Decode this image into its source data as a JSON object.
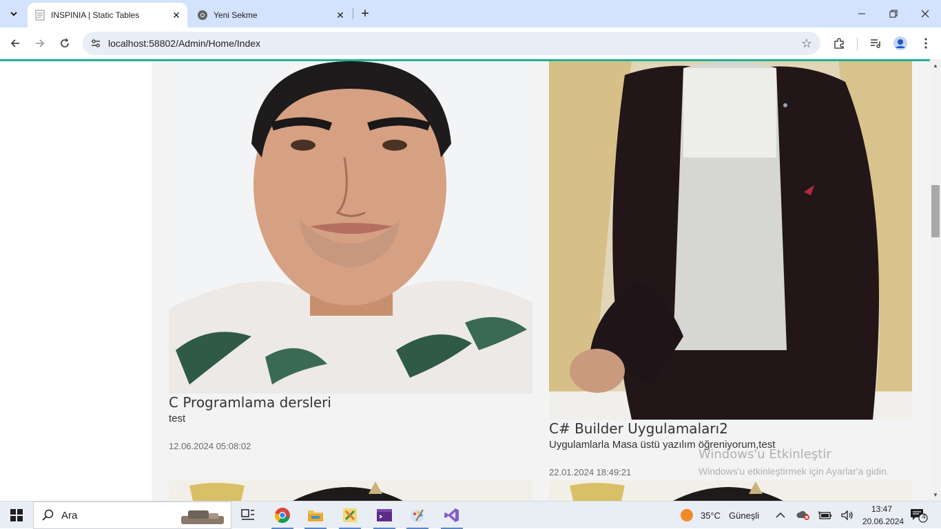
{
  "browser": {
    "tabs": [
      {
        "title": "INSPINIA | Static Tables",
        "active": true
      },
      {
        "title": "Yeni Sekme",
        "active": false
      }
    ],
    "url": "localhost:58802/Admin/Home/Index"
  },
  "colors": {
    "accent": "#1ab394",
    "tabstrip": "#d3e3fd",
    "content_bg": "#f3f3f4"
  },
  "cards": [
    {
      "title": "C Programlama dersleri",
      "description": "test",
      "date": "12.06.2024 05:08:02"
    },
    {
      "title": "C# Builder Uygulamaları2",
      "description": "Uygulamlarla Masa üstü yazılım öğreniyorum,test",
      "date": "22.01.2024 18:49:21"
    }
  ],
  "watermark": {
    "title": "Windows'u Etkinleştir",
    "subtitle": "Windows'u etkinleştirmek için Ayarlar'a gidin."
  },
  "taskbar": {
    "search_placeholder": "Ara",
    "weather_temp": "35°C",
    "weather_text": "Güneşli",
    "time": "13:47",
    "date": "20.06.2024",
    "notification_count": "4"
  }
}
